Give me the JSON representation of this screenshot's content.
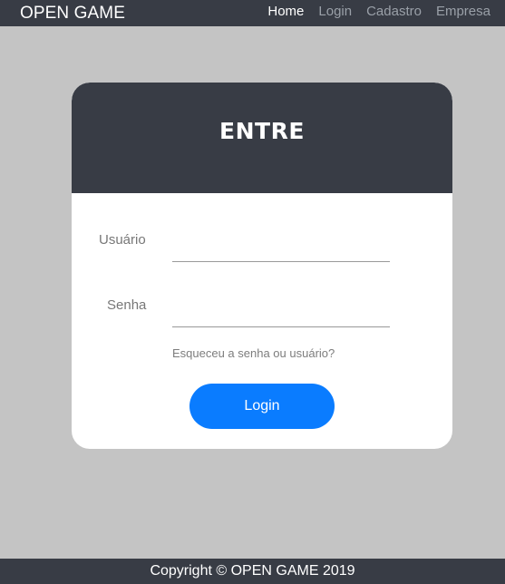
{
  "navbar": {
    "brand": "OPEN GAME",
    "links": [
      {
        "label": "Home",
        "active": true
      },
      {
        "label": "Login",
        "active": false
      },
      {
        "label": "Cadastro",
        "active": false
      },
      {
        "label": "Empresa",
        "active": false
      }
    ]
  },
  "login_card": {
    "title": "ENTRE",
    "username_label": "Usuário",
    "username_value": "",
    "password_label": "Senha",
    "password_value": "",
    "forgot_link": "Esqueceu a senha ou usuário?",
    "submit_label": "Login"
  },
  "footer": {
    "text": "Copyright © OPEN GAME 2019"
  },
  "colors": {
    "page_background": "#c4c4c4",
    "dark_bar": "#383c45",
    "accent_blue": "#0a7cff",
    "card_background": "#ffffff"
  }
}
